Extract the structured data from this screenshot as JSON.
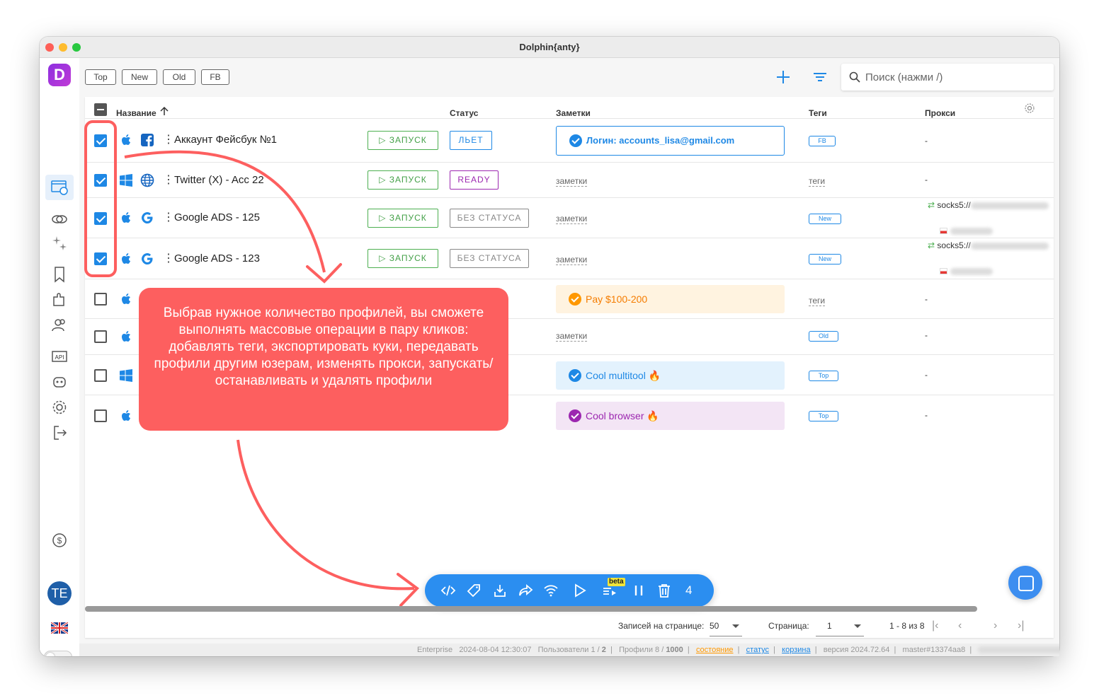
{
  "window": {
    "title": "Dolphin{anty}"
  },
  "toolbar": {
    "filter_tags": [
      "Top",
      "New",
      "Old",
      "FB"
    ],
    "search_placeholder": "Поиск (нажми /)"
  },
  "sidebar": {
    "avatar_initials": "TE"
  },
  "table": {
    "headers": {
      "name": "Название",
      "status": "Статус",
      "notes": "Заметки",
      "tags": "Теги",
      "proxy": "Прокси"
    },
    "launch_label": "ЗАПУСК",
    "notes_placeholder": "заметки",
    "tags_placeholder": "теги",
    "rows": [
      {
        "checked": true,
        "os": "apple",
        "site": "facebook",
        "name": "Аккаунт Фейсбук №1",
        "status": "ЛЬЕТ",
        "note": "Логин: accounts_lisa@gmail.com",
        "tag": "FB",
        "proxy": "-"
      },
      {
        "checked": true,
        "os": "windows",
        "site": "globe",
        "name": "Twitter (X) - Acc 22",
        "status": "READY",
        "note": "",
        "tag": "",
        "proxy": "-"
      },
      {
        "checked": true,
        "os": "apple",
        "site": "google",
        "name": "Google ADS - 125",
        "status": "БЕЗ СТАТУСА",
        "note": "",
        "tag": "New",
        "proxy": "socks5://"
      },
      {
        "checked": true,
        "os": "apple",
        "site": "google",
        "name": "Google ADS - 123",
        "status": "БЕЗ СТАТУСА",
        "note": "",
        "tag": "New",
        "proxy": "socks5://"
      },
      {
        "checked": false,
        "os": "apple",
        "note": "Pay $100-200",
        "tag": "",
        "proxy": "-"
      },
      {
        "checked": false,
        "os": "apple",
        "note": "",
        "tag": "Old",
        "proxy": "-"
      },
      {
        "checked": false,
        "os": "windows",
        "note": "Cool multitool 🔥",
        "tag": "Top",
        "proxy": "-"
      },
      {
        "checked": false,
        "os": "apple",
        "note": "Cool browser 🔥",
        "tag": "Top",
        "proxy": "-"
      }
    ],
    "colors": {
      "accent": "#1e88e5",
      "launch": "#43a047",
      "status_liet": "#1e88e5",
      "status_ready": "#9c27b0",
      "status_none": "#888888",
      "note_orange": "#fff3e0",
      "note_blue": "#e3f2fd",
      "note_purple": "#f3e5f5"
    }
  },
  "callout": {
    "text": "Выбрав нужное количество профилей, вы сможете выполнять массовые операции в пару кликов: добавлять теги, экспортировать куки, передавать профили другим юзерам, изменять прокси, запускать/останавливать и удалять профили"
  },
  "bulk_bar": {
    "icons": [
      "code-icon",
      "tag-icon",
      "download-icon",
      "share-icon",
      "wifi-icon",
      "play-icon",
      "queue-icon",
      "pause-icon",
      "trash-icon"
    ],
    "beta_label": "beta",
    "selected_count": "4"
  },
  "pager": {
    "per_page_label": "Записей на странице:",
    "per_page": "50",
    "page_label": "Страница:",
    "page": "1",
    "range": "1 - 8 из 8"
  },
  "statusbar": {
    "plan": "Enterprise",
    "datetime": "2024-08-04 12:30:07",
    "users_label": "Пользователи 1 /",
    "users_max": "2",
    "profiles_label": "Профили 8 /",
    "profiles_max": "1000",
    "link_state": "состояние",
    "link_status": "статус",
    "link_trash": "корзина",
    "version": "версия 2024.72.64",
    "branch": "master#13374aa8"
  }
}
